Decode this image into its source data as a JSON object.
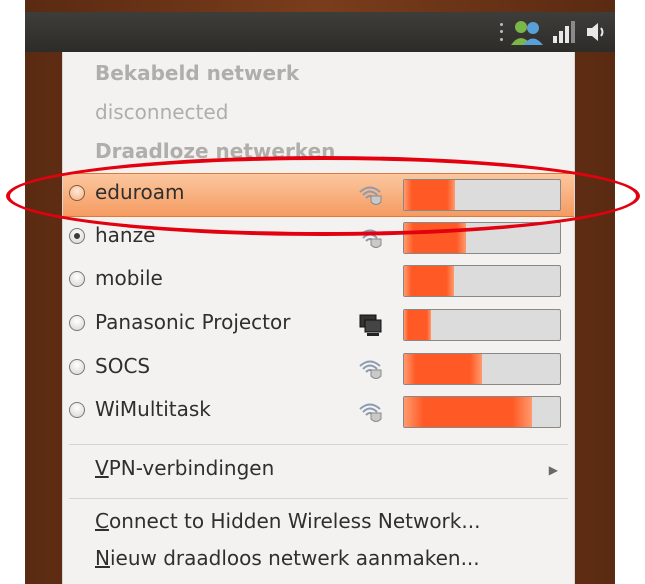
{
  "wired": {
    "header": "Bekabeld netwerk",
    "status": "disconnected"
  },
  "wireless": {
    "header": "Draadloze netwerken",
    "networks": [
      {
        "name": "eduroam",
        "selected": false,
        "highlighted": true,
        "icon": "secure-wifi-icon",
        "signal": 0.33
      },
      {
        "name": "hanze",
        "selected": true,
        "highlighted": false,
        "icon": "secure-wifi-icon",
        "signal": 0.4
      },
      {
        "name": "mobile",
        "selected": false,
        "highlighted": false,
        "icon": "",
        "signal": 0.32
      },
      {
        "name": "Panasonic Projector",
        "selected": false,
        "highlighted": false,
        "icon": "adhoc-computer-icon",
        "signal": 0.17
      },
      {
        "name": "SOCS",
        "selected": false,
        "highlighted": false,
        "icon": "secure-wifi-icon",
        "signal": 0.5
      },
      {
        "name": "WiMultitask",
        "selected": false,
        "highlighted": false,
        "icon": "secure-wifi-icon",
        "signal": 0.82
      }
    ]
  },
  "menu": {
    "vpn_mnemonic": "V",
    "vpn_rest": "PN-verbindingen",
    "hidden_mnemonic": "C",
    "hidden_rest": "onnect to Hidden Wireless Network...",
    "new_mnemonic": "N",
    "new_rest": "ieuw draadloos netwerk aanmaken..."
  },
  "tray": {
    "icons": [
      "users-icon",
      "network-signal-icon",
      "volume-icon"
    ]
  },
  "colors": {
    "highlight": "#f59b61",
    "signal_fill": "#ff5a26",
    "callout": "#e3000f",
    "panel": "#2d2c29"
  }
}
